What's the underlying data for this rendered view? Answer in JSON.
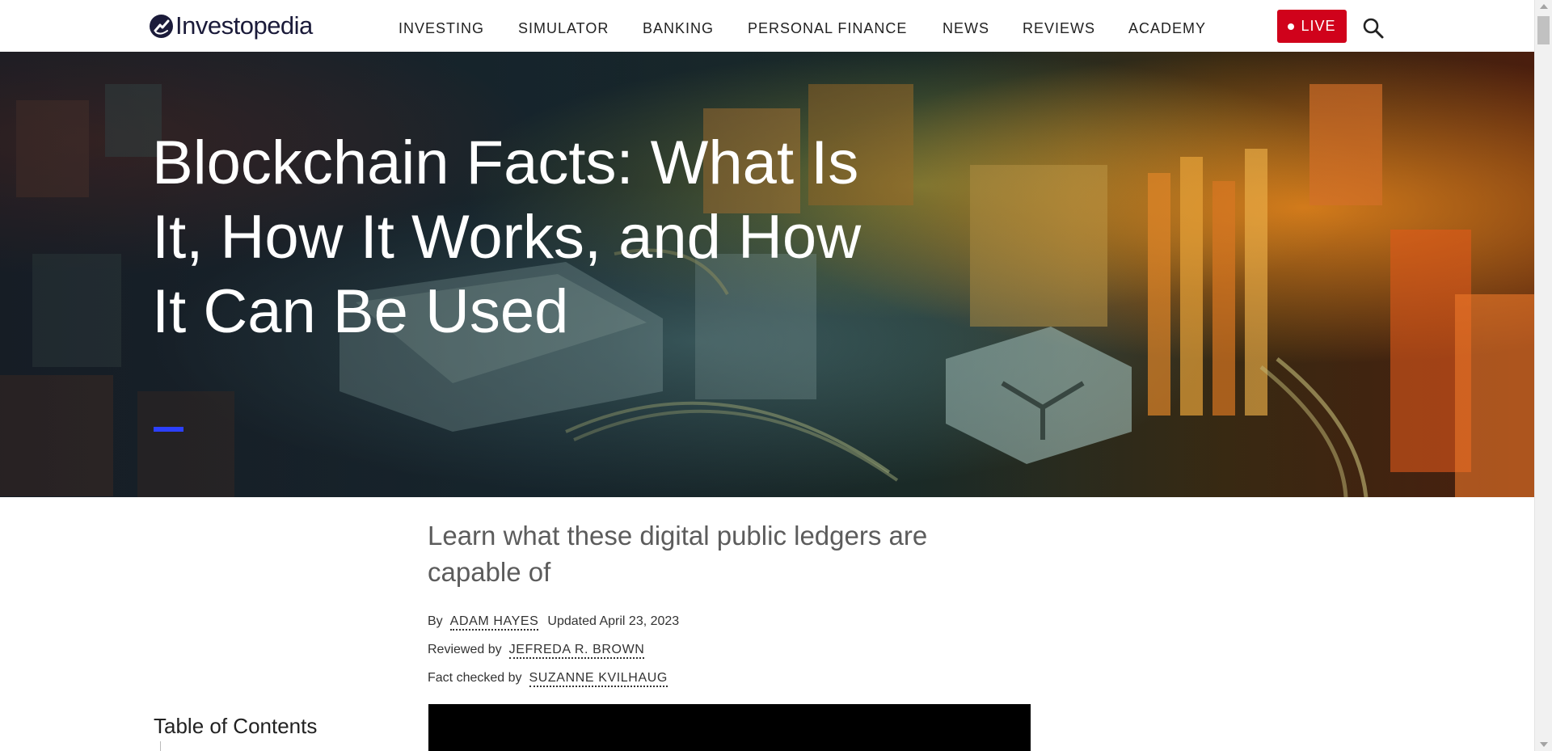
{
  "header": {
    "logo_text": "Investopedia",
    "nav": [
      {
        "label": "INVESTING"
      },
      {
        "label": "SIMULATOR"
      },
      {
        "label": "BANKING"
      },
      {
        "label": "PERSONAL FINANCE"
      },
      {
        "label": "NEWS"
      },
      {
        "label": "REVIEWS"
      },
      {
        "label": "ACADEMY"
      }
    ],
    "live_label": "LIVE",
    "search_icon": "search-icon"
  },
  "hero": {
    "title": "Blockchain Facts: What Is It, How It Works, and How It Can Be Used"
  },
  "article": {
    "subtitle": "Learn what these digital public ledgers are capable of",
    "byline": {
      "by_label": "By",
      "author": "ADAM HAYES",
      "updated": "Updated April 23, 2023",
      "reviewed_label": "Reviewed by",
      "reviewer": "JEFREDA R. BROWN",
      "fact_label": "Fact checked by",
      "fact_checker": "SUZANNE KVILHAUG"
    }
  },
  "toc": {
    "title": "Table of Contents"
  },
  "colors": {
    "brand_navy": "#1b1b3a",
    "live_red": "#d0021b",
    "accent_blue": "#2c40ff"
  }
}
